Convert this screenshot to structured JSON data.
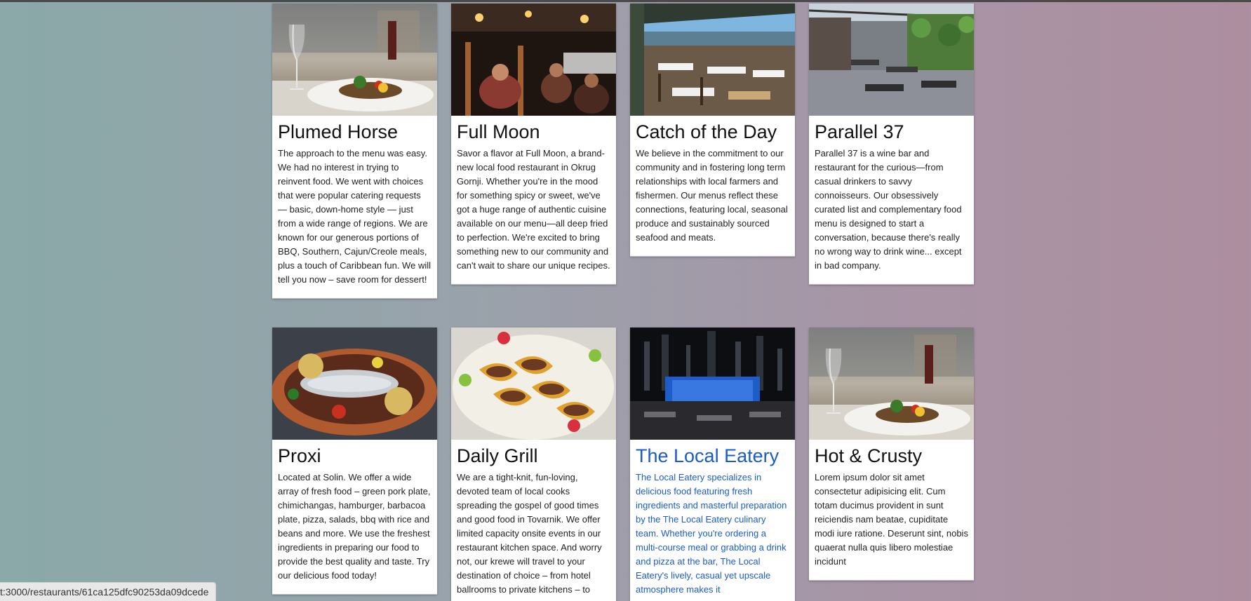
{
  "restaurants": [
    {
      "name": "Plumed Horse",
      "image": "plated-meal-wine-photo",
      "description": "The approach to the menu was easy. We had no interest in trying to reinvent food. We went with choices that were popular catering requests — basic, down-home style — just from a wide range of regions. We are known for our generous portions of BBQ, Southern, Cajun/Creole meals, plus a touch of Caribbean fun. We will tell you now – save room for dessert!"
    },
    {
      "name": "Full Moon",
      "image": "night-patio-diners-photo",
      "description": "Savor a flavor at Full Moon, a brand-new local food restaurant in Okrug Gornji. Whether you're in the mood for something spicy or sweet, we've got a huge range of authentic cuisine available on our menu—all deep fried to perfection. We're excited to bring something new to our community and can't wait to share our unique recipes."
    },
    {
      "name": "Catch of the Day",
      "image": "rooftop-terrace-photo",
      "description": "We believe in the commitment to our community and in fostering long term relationships with local farmers and fishermen. Our menus reflect these connections, featuring local, seasonal produce and sustainably sourced seafood and meats."
    },
    {
      "name": "Parallel 37",
      "image": "courtyard-dining-photo",
      "description": "Parallel 37 is a wine bar and restaurant for the curious—from casual drinkers to savvy connoisseurs. Our obsessively curated list and complementary food menu is designed to start a conversation, because there's really no wrong way to drink wine... except in bad company."
    },
    {
      "name": "Proxi",
      "image": "roasted-fish-platter-photo",
      "description": "Located at Solin. We offer a wide array of fresh food – green pork plate, chimichangas, hamburger, barbacoa plate, pizza, salads, bbq with rice and beans and more. We use the freshest ingredients in preparing our food to provide the best quality and taste. Try our delicious food today!"
    },
    {
      "name": "Daily Grill",
      "image": "tacos-plate-photo",
      "description": "We are a tight-knit, fun-loving, devoted team of local cooks spreading the gospel of good times and good food in Tovarnik. We offer limited capacity onsite events in our restaurant kitchen space. And worry not, our krewe will travel to your destination of choice – from hotel ballrooms to private kitchens – to"
    },
    {
      "name": "The Local Eatery",
      "image": "city-night-dining-room-photo",
      "description": "The Local Eatery specializes in delicious food featuring fresh ingredients and masterful preparation by the The Local Eatery culinary team. Whether you're ordering a multi-course meal or grabbing a drink and pizza at the bar, The Local Eatery's lively, casual yet upscale atmosphere makes it"
    },
    {
      "name": "Hot & Crusty",
      "image": "plated-meal-wine-photo",
      "description": "Lorem ipsum dolor sit amet consectetur adipisicing elit. Cum totam ducimus provident in sunt reiciendis nam beatae, cupiditate modi iure ratione. Deserunt sint, nobis quaerat nulla quis libero molestiae incidunt"
    }
  ],
  "status_bar": {
    "url": "t:3000/restaurants/61ca125dfc90253da09dcede"
  },
  "colors": {
    "link_hover": "#1a5cc8",
    "card_bg": "#ffffff"
  }
}
